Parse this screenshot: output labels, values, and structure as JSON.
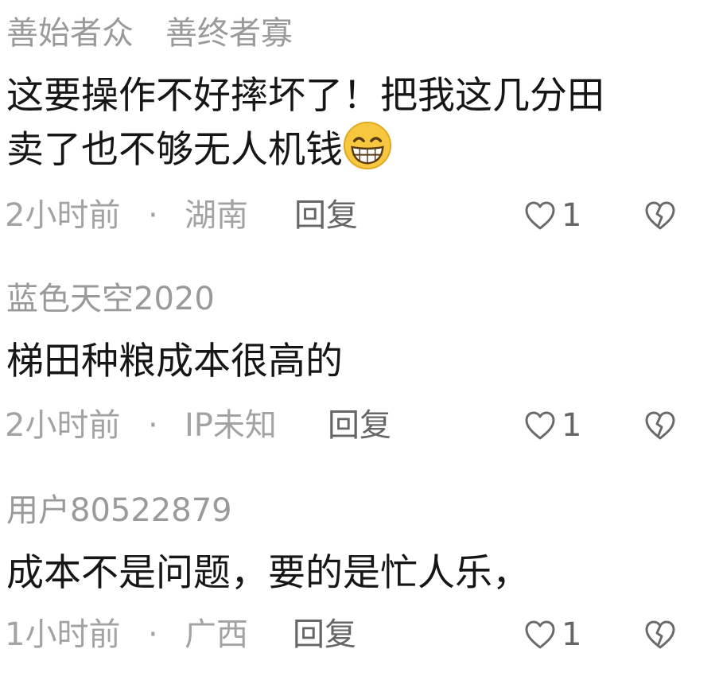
{
  "comments": [
    {
      "username": "善始者众　善终者寡",
      "lines": [
        "这要操作不好摔坏了！把我这几分田",
        "卖了也不够无人机钱"
      ],
      "emoji": "grinning-face-emoji",
      "time": "2小时前",
      "separator": "·",
      "location": "湖南",
      "reply": "回复",
      "likes": "1"
    },
    {
      "username": "蓝色天空2020",
      "lines": [
        "梯田种粮成本很高的"
      ],
      "time": "2小时前",
      "separator": "·",
      "location": "IP未知",
      "reply": "回复",
      "likes": "1"
    },
    {
      "username": "用户80522879",
      "lines": [
        "成本不是问题，要的是忙人乐，"
      ],
      "time": "1小时前",
      "separator": "·",
      "location": "广西",
      "reply": "回复",
      "likes": "1"
    }
  ],
  "icons": {
    "like": "heart-outline-icon",
    "dislike": "broken-heart-icon"
  },
  "colors": {
    "username": "#9a9a9a",
    "text": "#161616",
    "meta": "#a3a3a3",
    "action": "#666666"
  }
}
